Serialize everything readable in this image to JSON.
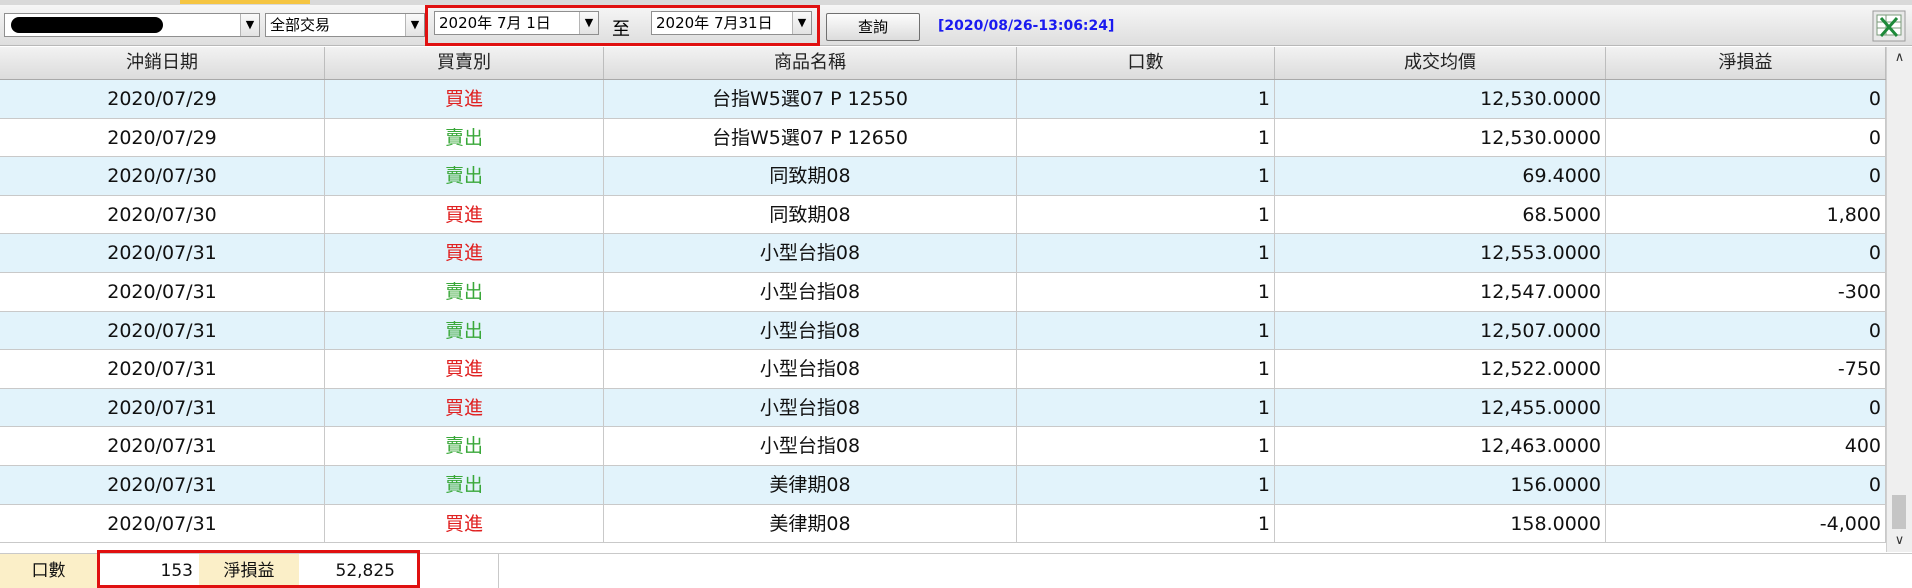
{
  "toolbar": {
    "account_value": "",
    "trade_filter": "全部交易",
    "date_from": "2020年  7月  1日",
    "to_label": "至",
    "date_to": "2020年  7月31日",
    "query_button": "查詢",
    "timestamp": "[2020/08/26-13:06:24]",
    "export_icon": "excel-export-icon"
  },
  "table": {
    "headers": [
      "沖銷日期",
      "買賣別",
      "商品名稱",
      "口數",
      "成交均價",
      "淨損益"
    ],
    "rows": [
      {
        "date": "2020/07/29",
        "side": "買進",
        "side_type": "buy",
        "product": "台指W5選07 P 12550",
        "qty": "1",
        "avg": "12,530.0000",
        "pnl": "0"
      },
      {
        "date": "2020/07/29",
        "side": "賣出",
        "side_type": "sell",
        "product": "台指W5選07 P 12650",
        "qty": "1",
        "avg": "12,530.0000",
        "pnl": "0"
      },
      {
        "date": "2020/07/30",
        "side": "賣出",
        "side_type": "sell",
        "product": "同致期08",
        "qty": "1",
        "avg": "69.4000",
        "pnl": "0"
      },
      {
        "date": "2020/07/30",
        "side": "買進",
        "side_type": "buy",
        "product": "同致期08",
        "qty": "1",
        "avg": "68.5000",
        "pnl": "1,800"
      },
      {
        "date": "2020/07/31",
        "side": "買進",
        "side_type": "buy",
        "product": "小型台指08",
        "qty": "1",
        "avg": "12,553.0000",
        "pnl": "0"
      },
      {
        "date": "2020/07/31",
        "side": "賣出",
        "side_type": "sell",
        "product": "小型台指08",
        "qty": "1",
        "avg": "12,547.0000",
        "pnl": "-300"
      },
      {
        "date": "2020/07/31",
        "side": "賣出",
        "side_type": "sell",
        "product": "小型台指08",
        "qty": "1",
        "avg": "12,507.0000",
        "pnl": "0"
      },
      {
        "date": "2020/07/31",
        "side": "買進",
        "side_type": "buy",
        "product": "小型台指08",
        "qty": "1",
        "avg": "12,522.0000",
        "pnl": "-750"
      },
      {
        "date": "2020/07/31",
        "side": "買進",
        "side_type": "buy",
        "product": "小型台指08",
        "qty": "1",
        "avg": "12,455.0000",
        "pnl": "0"
      },
      {
        "date": "2020/07/31",
        "side": "賣出",
        "side_type": "sell",
        "product": "小型台指08",
        "qty": "1",
        "avg": "12,463.0000",
        "pnl": "400"
      },
      {
        "date": "2020/07/31",
        "side": "賣出",
        "side_type": "sell",
        "product": "美律期08",
        "qty": "1",
        "avg": "156.0000",
        "pnl": "0"
      },
      {
        "date": "2020/07/31",
        "side": "買進",
        "side_type": "buy",
        "product": "美律期08",
        "qty": "1",
        "avg": "158.0000",
        "pnl": "-4,000"
      }
    ]
  },
  "footer": {
    "qty_label": "口數",
    "qty_value": "153",
    "pnl_label": "淨損益",
    "pnl_value": "52,825"
  },
  "colors": {
    "buy": "#e02020",
    "sell": "#3aa83a",
    "timestamp": "#1a1af0",
    "highlight_box": "#e01010",
    "alt_row": "#e2f3fb",
    "footer_label_bg": "#fbefc8"
  }
}
